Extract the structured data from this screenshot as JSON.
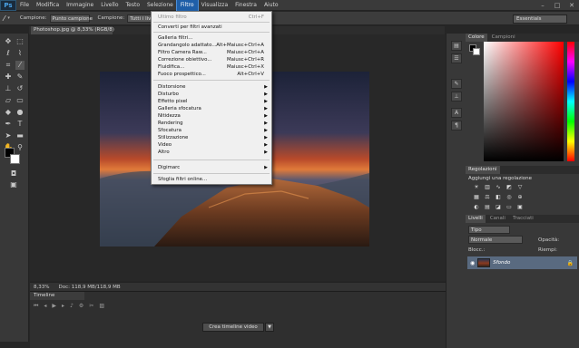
{
  "app": {
    "logo": "Ps",
    "accent": "#1f5fa8"
  },
  "menubar": {
    "items": [
      "File",
      "Modifica",
      "Immagine",
      "Livello",
      "Testo",
      "Selezione",
      "Filtro",
      "Visualizza",
      "Finestra",
      "Aiuto"
    ],
    "active": "Filtro",
    "window_controls": [
      "–",
      "□",
      "✕"
    ]
  },
  "options": {
    "sample_label": "Campione:",
    "sample_value": "Punto campione",
    "sample2_label": "Campione:",
    "sample2_value": "Tutti i livelli",
    "workspace": "Essentials"
  },
  "document": {
    "tab_title": "Photoshop.jpg @ 8,33% (RGB/8)"
  },
  "status": {
    "zoom": "8,33%",
    "doc": "Doc: 118,9 MB/118,9 MB"
  },
  "timeline": {
    "title": "Timeline",
    "create_button": "Crea timeline video",
    "arrow": "▼"
  },
  "right_panels": {
    "color_tabs": [
      "Colore",
      "Campioni"
    ],
    "adjust_tab": "Regolazioni",
    "adjust_title": "Aggiungi una regolazione",
    "layers_tabs": [
      "Livelli",
      "Canali",
      "Tracciati"
    ],
    "filter_kind": "Tipo",
    "blend_mode": "Normale",
    "opacity_label": "Opacità:",
    "lock_label": "Blocc.:",
    "fill_label": "Riempi:",
    "layer_name": "Sfondo"
  },
  "filter_menu": {
    "last_filter": {
      "label": "Ultimo filtro",
      "shortcut": "Ctrl+F"
    },
    "smart": "Converti per filtri avanzati",
    "group1": [
      {
        "label": "Galleria filtri..."
      },
      {
        "label": "Grandangolo adattato...",
        "shortcut": "Alt+Maiusc+Ctrl+A"
      },
      {
        "label": "Filtro Camera Raw...",
        "shortcut": "Maiusc+Ctrl+A"
      },
      {
        "label": "Correzione obiettivo...",
        "shortcut": "Maiusc+Ctrl+R"
      },
      {
        "label": "Fluidifica...",
        "shortcut": "Maiusc+Ctrl+X"
      },
      {
        "label": "Fuoco prospettico...",
        "shortcut": "Alt+Ctrl+V"
      }
    ],
    "submenus": [
      "Distorsione",
      "Disturbo",
      "Effetto pixel",
      "Galleria sfocatura",
      "Nitidezza",
      "Rendering",
      "Sfocatura",
      "Stilizzazione",
      "Video",
      "Altro"
    ],
    "digimarc": "Digimarc",
    "browse": "Sfoglia filtri online..."
  }
}
